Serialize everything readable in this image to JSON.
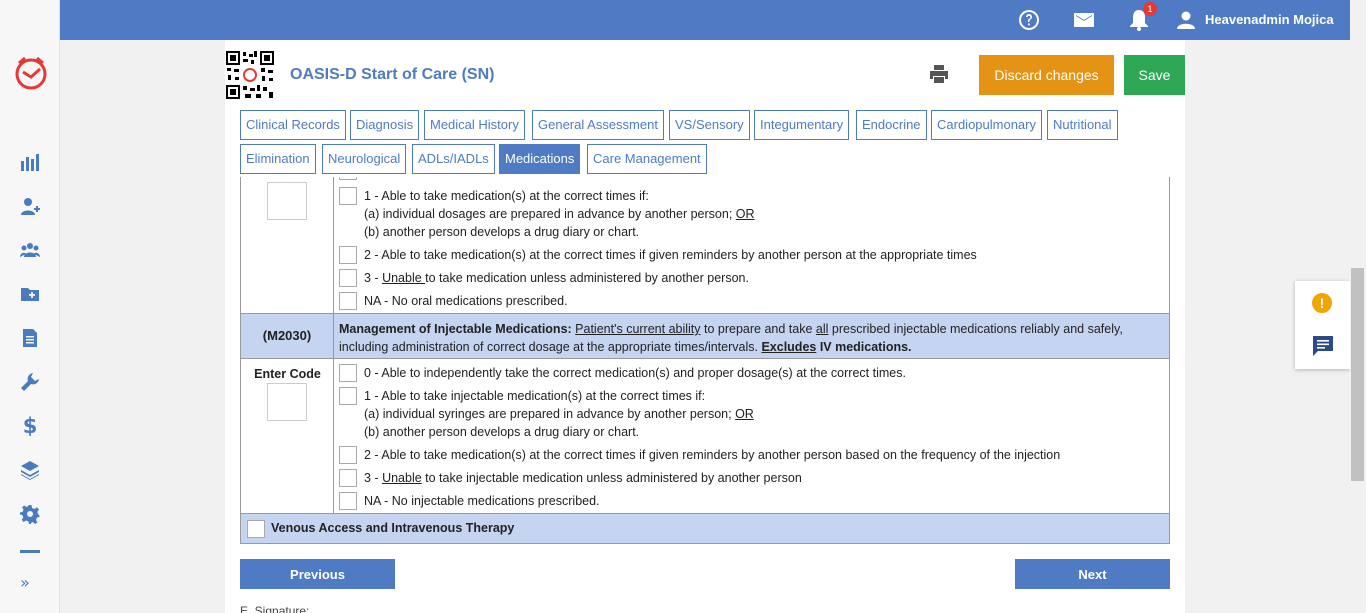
{
  "topbar": {
    "user_name": "Heavenadmin Mojica",
    "notification_count": "1",
    "icons": [
      "help-icon",
      "mail-icon",
      "bell-icon",
      "user-icon"
    ]
  },
  "sidebar": {
    "icons": [
      "chart-icon",
      "add-patient-icon",
      "team-icon",
      "add-folder-icon",
      "document-icon",
      "wrench-icon",
      "dollar-icon",
      "layers-icon",
      "gear-icon"
    ],
    "dollar": "$",
    "expand": "»"
  },
  "header": {
    "title": "OASIS-D Start of Care (SN)",
    "discard_label": "Discard changes",
    "save_label": "Save"
  },
  "tabs": [
    {
      "label": "Clinical Records"
    },
    {
      "label": "Diagnosis"
    },
    {
      "label": "Medical History"
    },
    {
      "label": "General Assessment"
    },
    {
      "label": "VS/Sensory"
    },
    {
      "label": "Integumentary"
    },
    {
      "label": "Endocrine"
    },
    {
      "label": "Cardiopulmonary"
    },
    {
      "label": "Nutritional"
    },
    {
      "label": "Elimination"
    },
    {
      "label": "Neurological"
    },
    {
      "label": "ADLs/IADLs"
    },
    {
      "label": "Medications",
      "active": true
    },
    {
      "label": "Care Management"
    }
  ],
  "m2020_options": {
    "opt1_line1": "1 - Able to take medication(s) at the correct times if:",
    "opt1_line2a": "(a) individual dosages are prepared in advance by another person; ",
    "opt1_line2b": "OR",
    "opt1_line3": "(b) another person develops a drug diary or chart.",
    "opt2": "2 - Able to take medication(s) at the correct times if given reminders by another person at the appropriate times",
    "opt3a": "3 - ",
    "opt3b": "Unable ",
    "opt3c": "to take medication unless administered by another person.",
    "optNA": "NA - No oral medications prescribed."
  },
  "m2030": {
    "code": "(M2030)",
    "title": "Management of Injectable Medications:",
    "t1": "Patient's current ability",
    "t2": " to prepare and take ",
    "t3": "all",
    "t4": " prescribed injectable medications reliably and safely, including administration of correct dosage at the appropriate times/intervals. ",
    "t5": "Excludes",
    "t6": " IV medications.",
    "enter_code": "Enter Code",
    "opt0": "0 - Able to independently take the correct medication(s) and proper dosage(s) at the correct times.",
    "opt1_line1": "1 - Able to take injectable medication(s) at the correct times if:",
    "opt1_line2a": "(a) individual syringes are prepared in advance by another person; ",
    "opt1_line2b": "OR",
    "opt1_line3": "(b) another person develops a drug diary or chart.",
    "opt2": "2 - Able to take medication(s) at the correct times if given reminders by another person based on the frequency of the injection",
    "opt3a": "3 - ",
    "opt3b": "Unable",
    "opt3c": " to take injectable medication unless administered by another person",
    "optNA": "NA - No injectable medications prescribed."
  },
  "venous": {
    "label": "Venous Access and Intravenous Therapy"
  },
  "nav": {
    "previous": "Previous",
    "next": "Next"
  },
  "footer": {
    "signature": "E. Signature:"
  },
  "float": {
    "warn": "!"
  }
}
